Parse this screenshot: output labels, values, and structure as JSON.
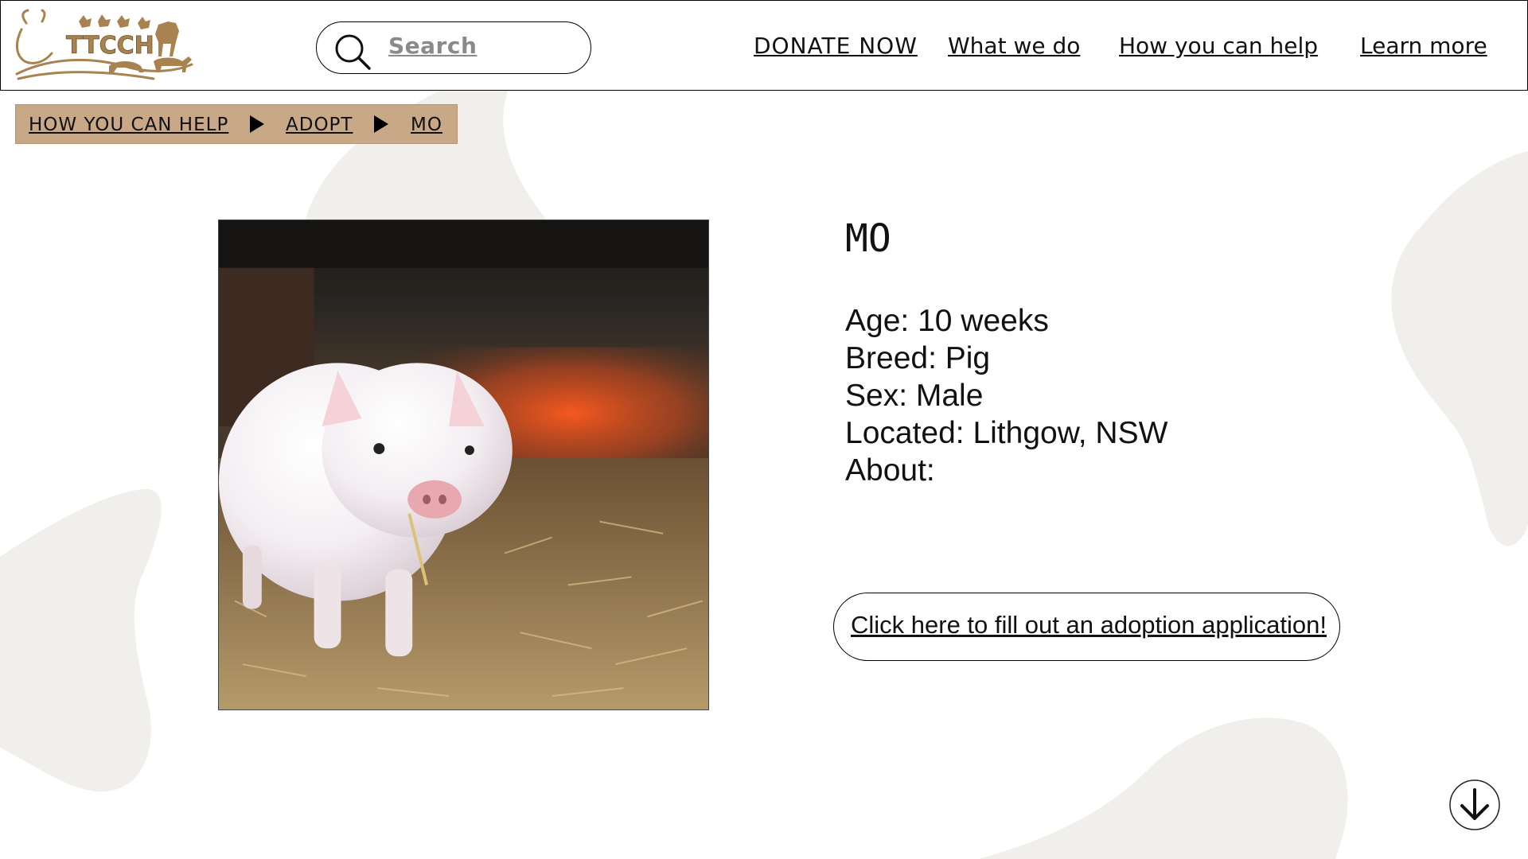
{
  "header": {
    "logo_text": "TTCCH",
    "search": {
      "placeholder": "Search"
    },
    "nav": {
      "donate": "DONATE NOW",
      "what_we_do": "What we do",
      "how_you_can_help": "How you can help",
      "learn_more": "Learn more"
    }
  },
  "breadcrumb": {
    "items": [
      "HOW YOU CAN HELP",
      "ADOPT",
      "MO"
    ]
  },
  "animal": {
    "name": "MO",
    "age": "Age: 10 weeks",
    "breed": "Breed: Pig",
    "sex": "Sex: Male",
    "located": "Located: Lithgow, NSW",
    "about": "About:"
  },
  "actions": {
    "adopt_label": "Click here to fill out an adoption application!"
  },
  "icons": {
    "search": "search-icon",
    "scroll": "arrow-down-circle-icon",
    "breadcrumb_separator": "triangle-right-icon"
  },
  "colors": {
    "brand_brown": "#a9834f",
    "breadcrumb_bg": "#c8a886",
    "blob": "#f1efeb",
    "text": "#111111"
  }
}
